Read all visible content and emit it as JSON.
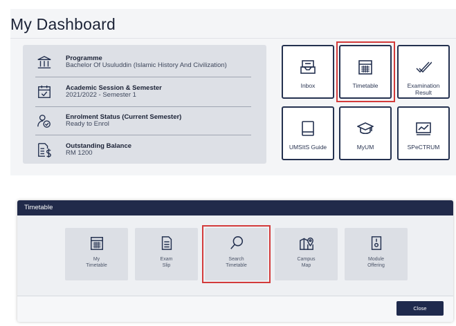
{
  "dashboard": {
    "title": "My Dashboard",
    "info": [
      {
        "icon": "building-icon",
        "label": "Programme",
        "value": "Bachelor Of Usuluddin (Islamic History And Civilization)"
      },
      {
        "icon": "calendar-check-icon",
        "label": "Academic Session & Semester",
        "value": "2021/2022 - Semester 1"
      },
      {
        "icon": "user-check-icon",
        "label": "Enrolment Status (Current Semester)",
        "value": "Ready to Enrol"
      },
      {
        "icon": "invoice-dollar-icon",
        "label": "Outstanding Balance",
        "value": "RM 1200"
      }
    ],
    "tiles": [
      {
        "label": "Inbox",
        "icon": "inbox-icon"
      },
      {
        "label": "Timetable",
        "icon": "calendar-grid-icon",
        "highlighted": true
      },
      {
        "label": "Examination Result",
        "icon": "checkmark-icon"
      },
      {
        "label": "UMSItS Guide",
        "icon": "book-icon"
      },
      {
        "label": "MyUM",
        "icon": "graduation-cap-icon"
      },
      {
        "label": "SPeCTRUM",
        "icon": "chart-monitor-icon"
      }
    ]
  },
  "modal": {
    "title": "Timetable",
    "tiles": [
      {
        "label": "My Timetable",
        "icon": "calendar-grid-icon"
      },
      {
        "label": "Exam Slip",
        "icon": "document-icon"
      },
      {
        "label": "Search Timetable",
        "icon": "search-icon",
        "highlighted": true
      },
      {
        "label": "Campus Map",
        "icon": "map-pin-icon"
      },
      {
        "label": "Module Offering",
        "icon": "module-icon"
      }
    ],
    "close_label": "Close"
  },
  "colors": {
    "navy": "#212a4a",
    "highlight": "#d33a3a",
    "card": "#dde0e6"
  }
}
